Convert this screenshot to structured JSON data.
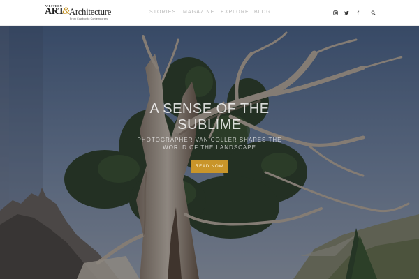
{
  "brand": {
    "western": "WESTERN",
    "art": "ART",
    "amp": "&",
    "architecture": "Architecture",
    "tagline": "From Cowboy to Contemporary",
    "accent_color": "#c9952a"
  },
  "nav": {
    "items": [
      "STORIES",
      "MAGAZINE",
      "EXPLORE",
      "BLOG"
    ]
  },
  "social": {
    "icons": [
      "instagram-icon",
      "twitter-icon",
      "facebook-icon",
      "search-icon"
    ]
  },
  "hero": {
    "title": "A SENSE OF THE SUBLIME",
    "subtitle": "PHOTOGRAPHER VAN COLLER SHAPES THE WORLD OF THE LANDSCAPE",
    "cta_label": "READ NOW"
  }
}
